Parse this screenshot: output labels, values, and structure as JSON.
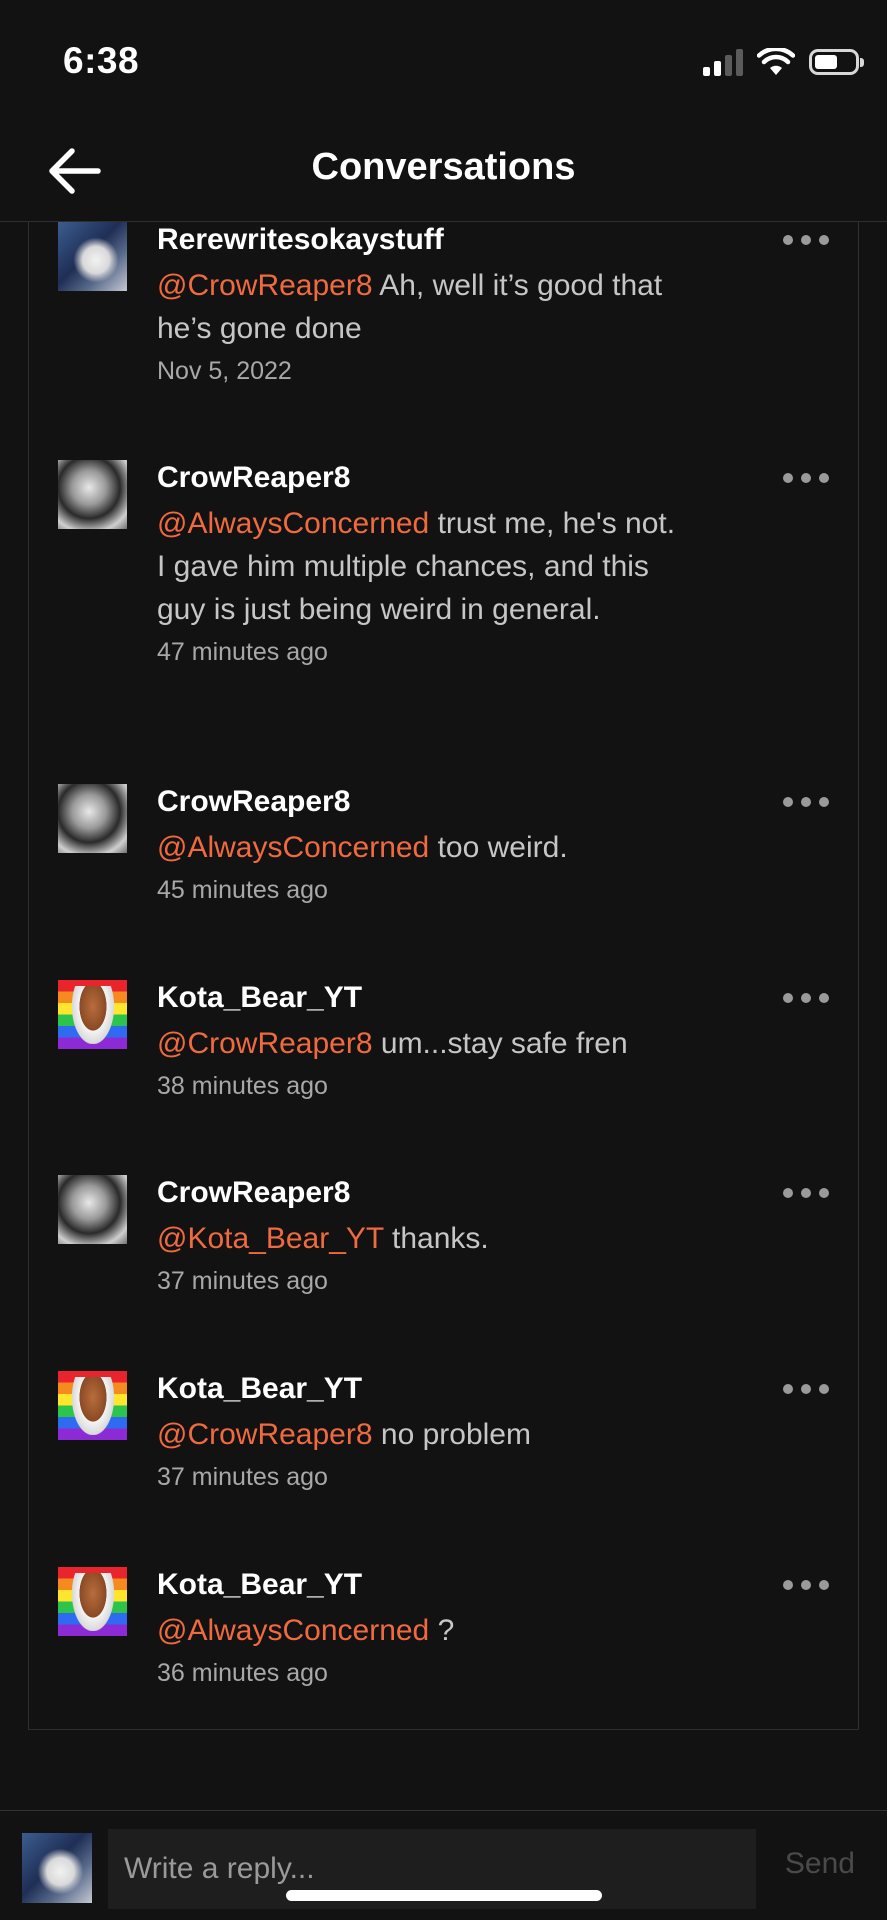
{
  "status_bar": {
    "time": "6:38",
    "signal_icon": "cellular-signal-icon",
    "wifi_icon": "wifi-icon",
    "battery_icon": "battery-icon"
  },
  "header": {
    "back_icon": "arrow-left-icon",
    "title": "Conversations"
  },
  "comments": [
    {
      "avatar": "cat-photo",
      "username": "Rerewritesokaystuff",
      "mention": "@CrowReaper8",
      "text": " Ah, well it’s good that he’s gone done",
      "timestamp": "Nov 5, 2022"
    },
    {
      "avatar": "crow-photo",
      "username": "CrowReaper8",
      "mention": "@AlwaysConcerned",
      "text": " trust me, he's not. I gave him multiple chances, and this guy is just being weird in general.",
      "timestamp": "47 minutes ago"
    },
    {
      "avatar": "crow-photo",
      "username": "CrowReaper8",
      "mention": "@AlwaysConcerned",
      "text": " too weird.",
      "timestamp": "45 minutes ago"
    },
    {
      "avatar": "rainbow-character",
      "username": "Kota_Bear_YT",
      "mention": "@CrowReaper8",
      "text": " um...stay safe fren",
      "timestamp": "38 minutes ago"
    },
    {
      "avatar": "crow-photo",
      "username": "CrowReaper8",
      "mention": "@Kota_Bear_YT",
      "text": " thanks.",
      "timestamp": "37 minutes ago"
    },
    {
      "avatar": "rainbow-character",
      "username": "Kota_Bear_YT",
      "mention": "@CrowReaper8",
      "text": " no problem",
      "timestamp": "37 minutes ago"
    },
    {
      "avatar": "rainbow-character",
      "username": "Kota_Bear_YT",
      "mention": "@AlwaysConcerned",
      "text": " ?",
      "timestamp": "36 minutes ago"
    }
  ],
  "more_icon": "more-horizontal-icon",
  "reply": {
    "placeholder": "Write a reply...",
    "send_label": "Send",
    "avatar": "cat-photo"
  }
}
